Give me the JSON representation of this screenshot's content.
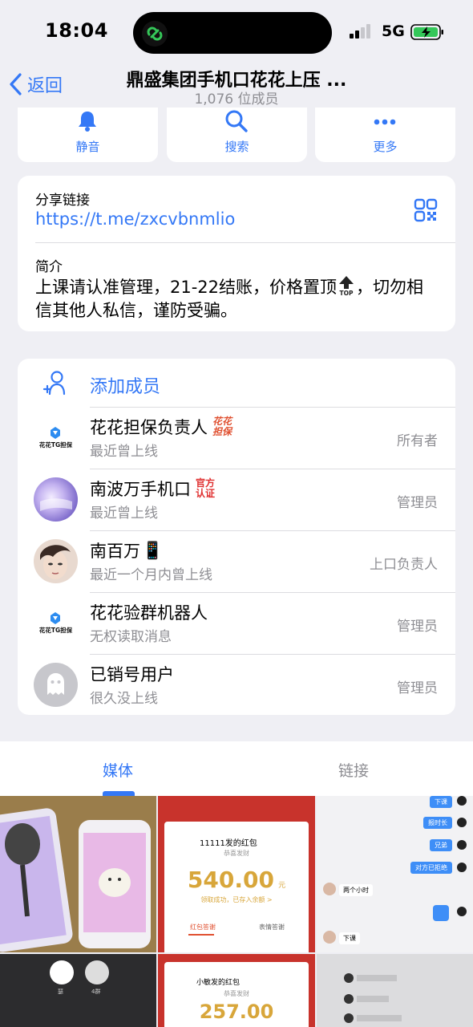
{
  "status": {
    "time": "18:04",
    "network": "5G"
  },
  "nav": {
    "back_label": "返回",
    "title": "鼎盛集团手机口花花上压 ...",
    "subtitle": "1,076 位成员"
  },
  "actions": [
    {
      "label": "静音",
      "icon": "bell-icon"
    },
    {
      "label": "搜索",
      "icon": "search-icon"
    },
    {
      "label": "更多",
      "icon": "more-icon"
    }
  ],
  "share": {
    "title": "分享链接",
    "link": "https://t.me/zxcvbnmlio"
  },
  "intro": {
    "title": "简介",
    "text_before": "上课请认准管理，21-22结账，价格置顶",
    "top_badge": "TOP",
    "text_after": "，切勿相信其他人私信，谨防受骗。"
  },
  "members": {
    "add_label": "添加成员",
    "list": [
      {
        "name": "花花担保负责人",
        "tag": "花花担保",
        "status": "最近曾上线",
        "role": "所有者",
        "avatar_text": "花花TG担保"
      },
      {
        "name": "南波万手机口",
        "tag": "官方认证",
        "status": "最近曾上线",
        "role": "管理员"
      },
      {
        "name": "南百万",
        "emoji": "📱",
        "status": "最近一个月内曾上线",
        "role": "上口负责人"
      },
      {
        "name": "花花验群机器人",
        "status": "无权读取消息",
        "role": "管理员",
        "avatar_text": "花花TG担保"
      },
      {
        "name": "已销号用户",
        "status": "很久没上线",
        "role": "管理员"
      }
    ]
  },
  "tabs": {
    "media": "媒体",
    "links": "链接"
  },
  "media": {
    "redpacket": {
      "sender": "11111发的红包",
      "greeting": "恭喜发财",
      "amount": "540.00",
      "unit": "元",
      "note": "领取成功，已存入余额 >",
      "tab_a": "红包答谢",
      "tab_b": "表情答谢"
    },
    "chat": {
      "bubbles": [
        "下课",
        "报时长",
        "兄弟",
        "对方已拒绝"
      ],
      "left_a": "两个小时",
      "left_b": "下课"
    },
    "bottom": {
      "packet_sender": "小敏发的红包",
      "packet_greeting": "恭喜发财",
      "packet_amount": "257.00",
      "contact_a": "瑟",
      "contact_b": "4群"
    }
  }
}
